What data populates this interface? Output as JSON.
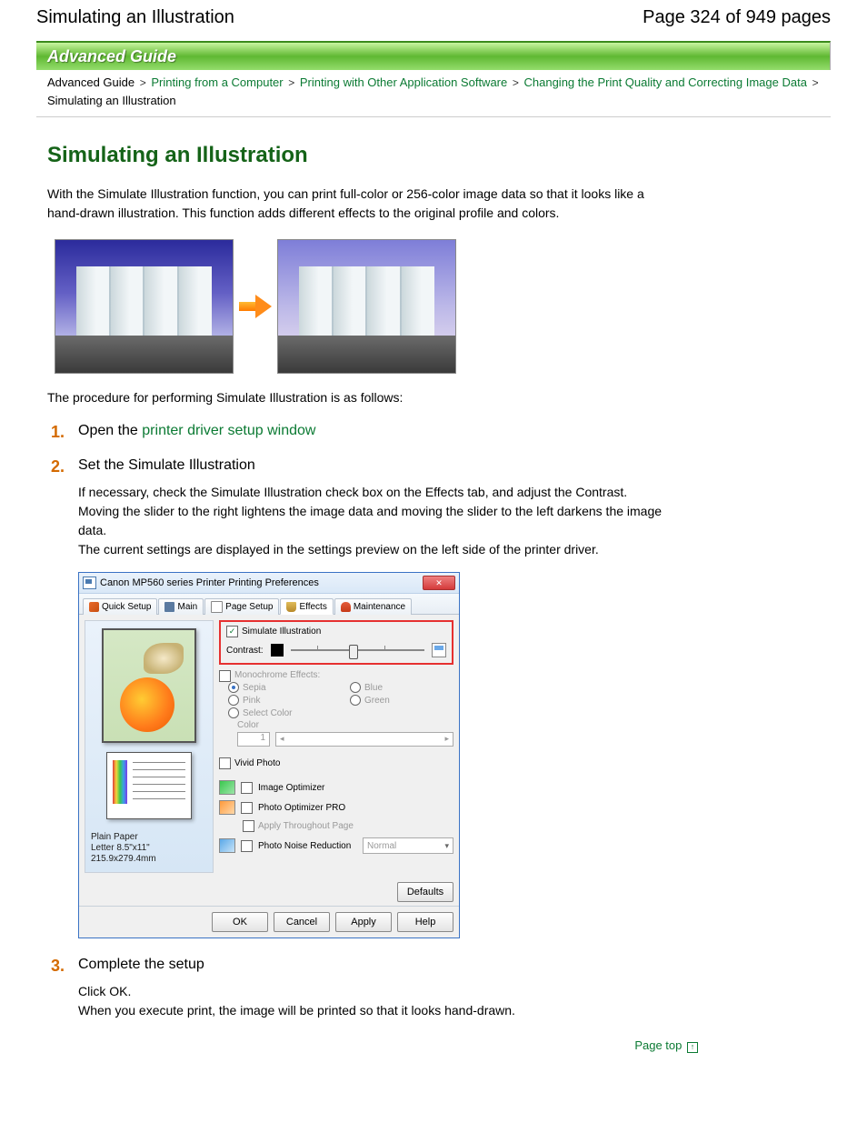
{
  "header": {
    "page_title": "Simulating an Illustration",
    "page_counter": "Page 324 of 949 pages"
  },
  "banner": {
    "label": "Advanced Guide"
  },
  "breadcrumb": {
    "items": [
      {
        "label": "Advanced Guide",
        "link": false
      },
      {
        "label": "Printing from a Computer",
        "link": true
      },
      {
        "label": "Printing with Other Application Software",
        "link": true
      },
      {
        "label": "Changing the Print Quality and Correcting Image Data",
        "link": true
      },
      {
        "label": "Simulating an Illustration",
        "link": false
      }
    ],
    "sep": ">"
  },
  "title": "Simulating an Illustration",
  "intro": "With the Simulate Illustration function, you can print full-color or 256-color image data so that it looks like a hand-drawn illustration. This function adds different effects to the original profile and colors.",
  "procedure_line": "The procedure for performing Simulate Illustration is as follows:",
  "steps": [
    {
      "title_prefix": "Open the ",
      "title_link": "printer driver setup window",
      "body": []
    },
    {
      "title": "Set the Simulate Illustration",
      "body": [
        "If necessary, check the Simulate Illustration check box on the Effects tab, and adjust the Contrast. Moving the slider to the right lightens the image data and moving the slider to the left darkens the image data.",
        "The current settings are displayed in the settings preview on the left side of the printer driver."
      ]
    },
    {
      "title": "Complete the setup",
      "body": [
        "Click OK.",
        "When you execute print, the image will be printed so that it looks hand-drawn."
      ]
    }
  ],
  "dialog": {
    "title": "Canon MP560 series Printer Printing Preferences",
    "close_glyph": "✕",
    "tabs": [
      "Quick Setup",
      "Main",
      "Page Setup",
      "Effects",
      "Maintenance"
    ],
    "active_tab": 3,
    "media": {
      "type": "Plain Paper",
      "size": "Letter 8.5\"x11\" 215.9x279.4mm"
    },
    "simulate": {
      "label": "Simulate Illustration",
      "checked": true,
      "contrast_label": "Contrast:"
    },
    "monochrome": {
      "label": "Monochrome Effects:",
      "options": [
        "Sepia",
        "Blue",
        "Pink",
        "Green",
        "Select Color"
      ],
      "selected": 0,
      "color_label": "Color",
      "color_value": "1"
    },
    "vivid": {
      "label": "Vivid Photo"
    },
    "image_opt": {
      "label": "Image Optimizer"
    },
    "photo_opt": {
      "label": "Photo Optimizer PRO",
      "apply": "Apply Throughout Page"
    },
    "noise": {
      "label": "Photo Noise Reduction",
      "value": "Normal"
    },
    "defaults": "Defaults",
    "buttons": [
      "OK",
      "Cancel",
      "Apply",
      "Help"
    ]
  },
  "page_top": "Page top"
}
